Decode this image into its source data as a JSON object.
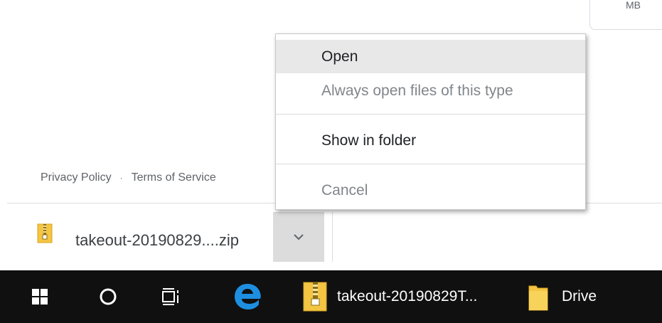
{
  "size_card": {
    "text": "MB"
  },
  "footer": {
    "privacy": "Privacy Policy",
    "separator": "·",
    "terms": "Terms of Service"
  },
  "download": {
    "filename": "takeout-20190829....zip"
  },
  "menu": {
    "items": [
      {
        "label": "Open",
        "state": "highlighted"
      },
      {
        "label": "Always open files of this type",
        "state": "disabled"
      },
      {
        "label": "Show in folder",
        "state": "enabled"
      },
      {
        "label": "Cancel",
        "state": "disabled"
      }
    ]
  },
  "taskbar": {
    "apps": [
      {
        "icon": "windows-start-icon"
      },
      {
        "icon": "cortana-search-icon"
      },
      {
        "icon": "task-view-icon"
      },
      {
        "icon": "edge-browser-icon"
      },
      {
        "icon": "zip-folder-icon",
        "label": "takeout-20190829T..."
      },
      {
        "icon": "folder-icon",
        "label": "Drive"
      }
    ]
  },
  "colors": {
    "folder_yellow": "#f4c542",
    "edge_blue": "#1e8fe0",
    "taskbar_bg": "#101010"
  }
}
